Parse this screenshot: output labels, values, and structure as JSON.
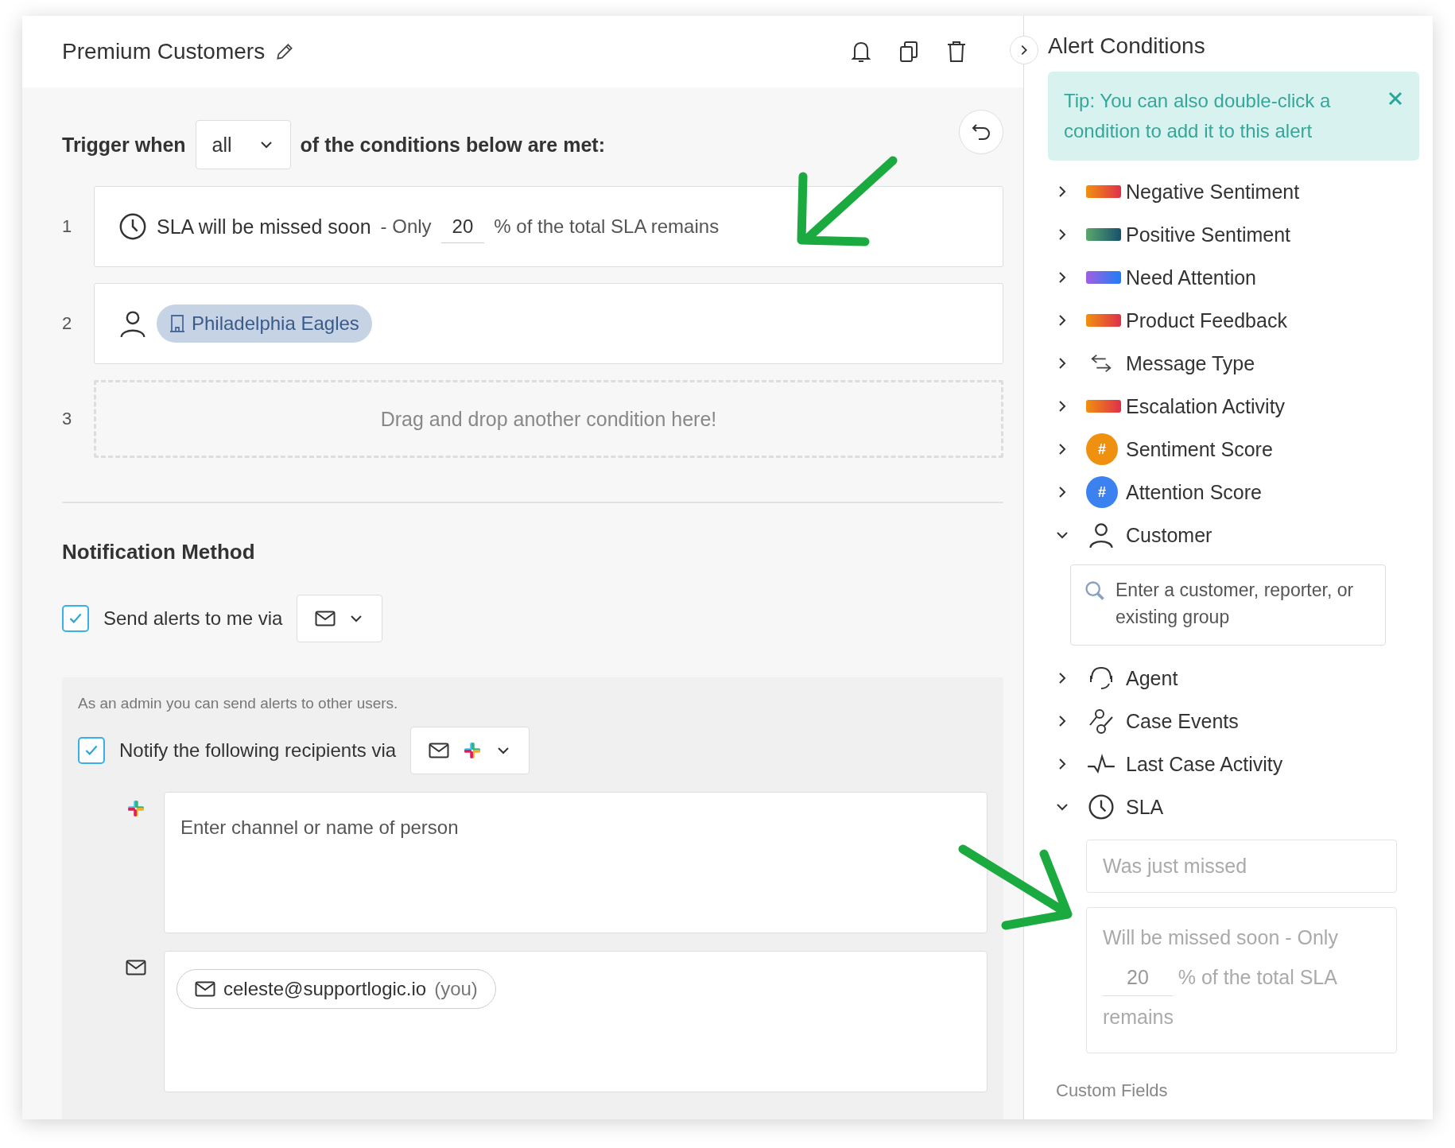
{
  "header": {
    "title": "Premium Customers"
  },
  "trigger": {
    "prefix": "Trigger when",
    "match": "all",
    "suffix": "of the conditions below are met:"
  },
  "conditions": [
    {
      "number": "1",
      "kind": "sla",
      "label": "SLA will be missed soon",
      "pre": "- Only",
      "value": "20",
      "post": "% of the total SLA remains"
    },
    {
      "number": "2",
      "kind": "customer",
      "tag": "Philadelphia Eagles"
    },
    {
      "number": "3",
      "kind": "dropzone",
      "text": "Drag and drop another condition here!"
    }
  ],
  "notification": {
    "heading": "Notification Method",
    "self": {
      "label": "Send alerts to me via",
      "checked": true,
      "methods": [
        {
          "kind": "email"
        }
      ]
    },
    "admin_note": "As an admin you can send alerts to other users.",
    "recipients": {
      "label": "Notify the following recipients via",
      "checked": true,
      "methods": [
        {
          "kind": "email"
        },
        {
          "kind": "slack"
        }
      ]
    },
    "slack_field": {
      "placeholder": "Enter channel or name of person"
    },
    "email_recipients": [
      {
        "email": "celeste@supportlogic.io",
        "note": "(you)"
      }
    ]
  },
  "sidebar": {
    "title": "Alert Conditions",
    "tip": "Tip: You can also double-click a condition to add it to this alert",
    "items": [
      {
        "label": "Negative Sentiment",
        "kind": "warm",
        "expanded": false
      },
      {
        "label": "Positive Sentiment",
        "kind": "green",
        "expanded": false
      },
      {
        "label": "Need Attention",
        "kind": "violet",
        "expanded": false
      },
      {
        "label": "Product Feedback",
        "kind": "warm",
        "expanded": false
      },
      {
        "label": "Message Type",
        "kind": "arrows",
        "expanded": false
      },
      {
        "label": "Escalation Activity",
        "kind": "warm",
        "expanded": false
      },
      {
        "label": "Sentiment Score",
        "kind": "score",
        "symbol": "#",
        "color": "#f0900f",
        "expanded": false
      },
      {
        "label": "Attention Score",
        "kind": "score",
        "symbol": "#",
        "color": "#3b82f0",
        "expanded": false
      },
      {
        "label": "Customer",
        "kind": "person",
        "expanded": true,
        "search": {
          "placeholder": "Enter a customer, reporter, or existing group"
        }
      },
      {
        "label": "Agent",
        "kind": "headset",
        "expanded": false
      },
      {
        "label": "Case Events",
        "kind": "events",
        "expanded": false
      },
      {
        "label": "Last Case Activity",
        "kind": "pulse",
        "expanded": false
      },
      {
        "label": "SLA",
        "kind": "clock",
        "expanded": true,
        "options": [
          {
            "kind": "plain",
            "text": "Was just missed"
          },
          {
            "kind": "threshold",
            "pre": "Will be missed soon - Only",
            "value": "20",
            "post": "% of the total SLA remains"
          }
        ]
      }
    ],
    "section": "Custom Fields"
  }
}
